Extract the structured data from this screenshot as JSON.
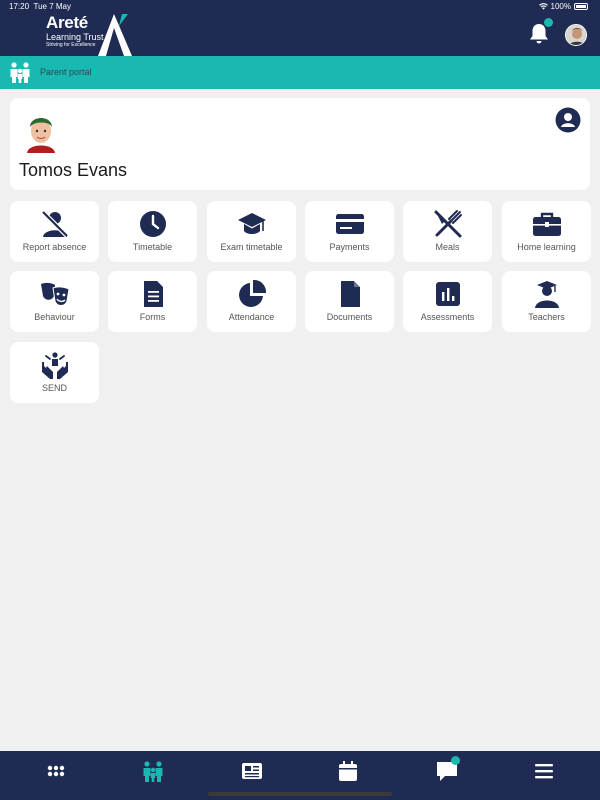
{
  "status_bar": {
    "time": "17:20",
    "date": "Tue 7 May",
    "battery": "100%"
  },
  "header": {
    "logo_title": "Areté",
    "logo_subtitle": "Learning Trust",
    "logo_tagline": "Striving for Excellence",
    "notification_icon": "bell-icon",
    "avatar_icon": "user-avatar"
  },
  "portal": {
    "label": "Parent portal",
    "icon": "family-icon"
  },
  "student": {
    "name": "Tomos Evans",
    "profile_icon": "user-circle-icon"
  },
  "tiles": [
    {
      "label": "Report absence",
      "icon": "absence-icon"
    },
    {
      "label": "Timetable",
      "icon": "clock-icon"
    },
    {
      "label": "Exam timetable",
      "icon": "graduation-cap-icon"
    },
    {
      "label": "Payments",
      "icon": "card-icon"
    },
    {
      "label": "Meals",
      "icon": "cutlery-icon"
    },
    {
      "label": "Home learning",
      "icon": "briefcase-icon"
    },
    {
      "label": "Behaviour",
      "icon": "masks-icon"
    },
    {
      "label": "Forms",
      "icon": "document-lines-icon"
    },
    {
      "label": "Attendance",
      "icon": "pie-chart-icon"
    },
    {
      "label": "Documents",
      "icon": "file-icon"
    },
    {
      "label": "Assessments",
      "icon": "bar-chart-icon"
    },
    {
      "label": "Teachers",
      "icon": "teacher-icon"
    },
    {
      "label": "SEND",
      "icon": "care-hands-icon"
    }
  ],
  "bottom_nav": [
    {
      "icon": "grid-icon"
    },
    {
      "icon": "family-icon",
      "active": true
    },
    {
      "icon": "newspaper-icon"
    },
    {
      "icon": "calendar-icon"
    },
    {
      "icon": "chat-icon"
    },
    {
      "icon": "menu-icon"
    }
  ],
  "colors": {
    "navy": "#1f2b52",
    "teal": "#19b8b0",
    "background": "#f0f0f0"
  }
}
